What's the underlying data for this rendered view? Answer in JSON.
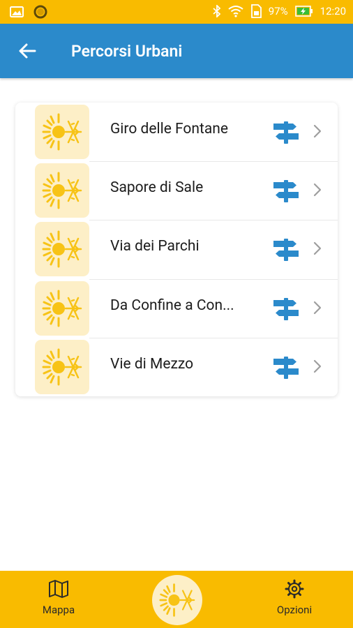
{
  "status": {
    "battery": "97%",
    "time": "12:20"
  },
  "header": {
    "title": "Percorsi Urbani",
    "back_icon": "back-arrow-icon"
  },
  "routes": [
    {
      "label": "Giro delle Fontane"
    },
    {
      "label": "Sapore di Sale"
    },
    {
      "label": "Via dei Parchi"
    },
    {
      "label": "Da Confine a Con..."
    },
    {
      "label": "Vie di Mezzo"
    }
  ],
  "bottom_nav": {
    "map_label": "Mappa",
    "options_label": "Opzioni"
  },
  "colors": {
    "primary": "#2b8acb",
    "accent": "#f9bb00",
    "icon_bg": "#fdefc7",
    "logo": "#f7c316"
  }
}
